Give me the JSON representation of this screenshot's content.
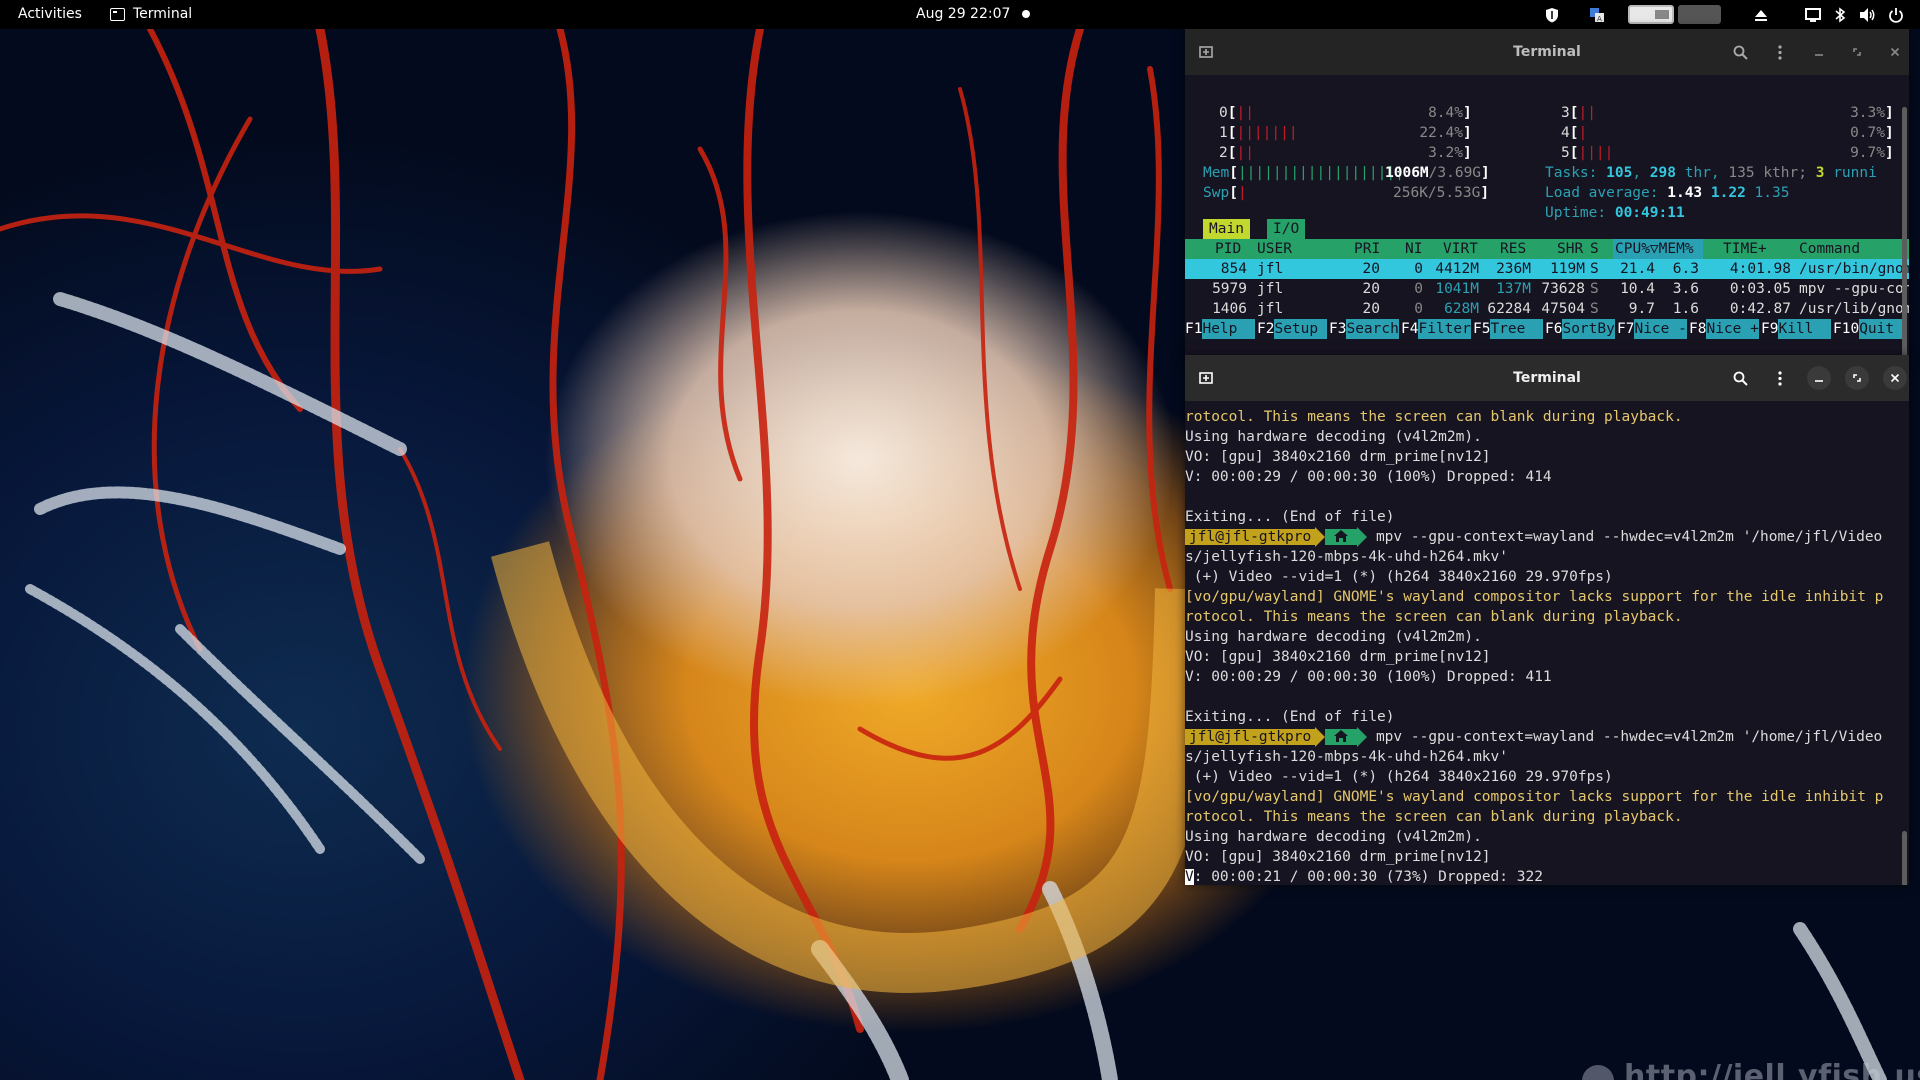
{
  "topbar": {
    "activities": "Activities",
    "app_name": "Terminal",
    "clock": "Aug 29  22:07",
    "icons": [
      "shield-icon",
      "translate-icon",
      "workspace-1",
      "workspace-2",
      "eject-icon",
      "display-icon",
      "bluetooth-icon",
      "volume-icon",
      "power-icon"
    ]
  },
  "wallpaper": {
    "watermark": "http://jell.yfish.us"
  },
  "term1": {
    "title": "Terminal",
    "htop": {
      "cpu": [
        {
          "id": "0",
          "bars": "||",
          "value": "8.4%"
        },
        {
          "id": "1",
          "bars": "|||||||",
          "value": "22.4%"
        },
        {
          "id": "2",
          "bars": "||",
          "value": "3.2%"
        },
        {
          "id": "3",
          "bars": "||",
          "value": "3.3%"
        },
        {
          "id": "4",
          "bars": "|",
          "value": "0.7%"
        },
        {
          "id": "5",
          "bars": "||||",
          "value": "9.7%"
        }
      ],
      "mem": {
        "label": "Mem",
        "bars": "|||||||||||||||||||",
        "used": "1006M",
        "total": "3.69G"
      },
      "swp": {
        "label": "Swp",
        "bars": "|",
        "used": "256K",
        "total": "5.53G"
      },
      "tasks": {
        "label": "Tasks:",
        "tasks": "105",
        "thr": "298",
        "thr_label": "thr,",
        "kthr": "135",
        "kthr_label": "kthr;",
        "running": "3",
        "running_label": "runni"
      },
      "load": {
        "label": "Load average:",
        "l1": "1.43",
        "l5": "1.22",
        "l15": "1.35"
      },
      "uptime": {
        "label": "Uptime:",
        "value": "00:49:11"
      },
      "tabs": {
        "main": "Main",
        "io": "I/O"
      },
      "header": {
        "pid": "PID",
        "user": "USER",
        "pri": "PRI",
        "ni": "NI",
        "virt": "VIRT",
        "res": "RES",
        "shr": "SHR",
        "s": "S",
        "cpu": "CPU%▽MEM%",
        "time": "TIME+",
        "command": "Command"
      },
      "processes": [
        {
          "pid": "854",
          "user": "jfl",
          "pri": "20",
          "ni": "0",
          "virt": "4412M",
          "res": "236M",
          "shr": "119M",
          "s": "S",
          "cpu": "21.4",
          "mem": "6.3",
          "time": "4:01.98",
          "command": "/usr/bin/gnom"
        },
        {
          "pid": "5979",
          "user": "jfl",
          "pri": "20",
          "ni": "0",
          "virt": "1041M",
          "res": "137M",
          "shr": "73628",
          "s": "S",
          "cpu": "10.4",
          "mem": "3.6",
          "time": "0:03.05",
          "command": "mpv --gpu-con"
        },
        {
          "pid": "1406",
          "user": "jfl",
          "pri": "20",
          "ni": "0",
          "virt": "628M",
          "res": "62284",
          "shr": "47504",
          "s": "S",
          "cpu": "9.7",
          "mem": "1.6",
          "time": "0:42.87",
          "command": "/usr/lib/gnom"
        }
      ],
      "fkeys": [
        {
          "key": "F1",
          "label": "Help  "
        },
        {
          "key": "F2",
          "label": "Setup "
        },
        {
          "key": "F3",
          "label": "Search"
        },
        {
          "key": "F4",
          "label": "Filter"
        },
        {
          "key": "F5",
          "label": "Tree  "
        },
        {
          "key": "F6",
          "label": "SortBy"
        },
        {
          "key": "F7",
          "label": "Nice -"
        },
        {
          "key": "F8",
          "label": "Nice +"
        },
        {
          "key": "F9",
          "label": "Kill  "
        },
        {
          "key": "F10",
          "label": "Quit "
        }
      ]
    }
  },
  "term2": {
    "title": "Terminal",
    "lines": [
      {
        "text": "rotocol. This means the screen can blank during playback.",
        "style": "yellow"
      },
      {
        "text": "Using hardware decoding (v4l2m2m).",
        "style": "plain"
      },
      {
        "text": "VO: [gpu] 3840x2160 drm_prime[nv12]",
        "style": "plain"
      },
      {
        "text": "V: 00:00:29 / 00:00:30 (100%) Dropped: 414",
        "style": "plain"
      },
      {
        "text": "",
        "style": "plain"
      },
      {
        "text": "Exiting... (End of file)",
        "style": "plain"
      },
      {
        "text": " mpv --gpu-context=wayland --hwdec=v4l2m2m '/home/jfl/Video",
        "style": "prompt",
        "user": "jfl@jfl-gtkpro"
      },
      {
        "text": "s/jellyfish-120-mbps-4k-uhd-h264.mkv'",
        "style": "plain"
      },
      {
        "text": " (+) Video --vid=1 (*) (h264 3840x2160 29.970fps)",
        "style": "plain"
      },
      {
        "text": "[vo/gpu/wayland] GNOME's wayland compositor lacks support for the idle inhibit p",
        "style": "yellow"
      },
      {
        "text": "rotocol. This means the screen can blank during playback.",
        "style": "yellow"
      },
      {
        "text": "Using hardware decoding (v4l2m2m).",
        "style": "plain"
      },
      {
        "text": "VO: [gpu] 3840x2160 drm_prime[nv12]",
        "style": "plain"
      },
      {
        "text": "V: 00:00:29 / 00:00:30 (100%) Dropped: 411",
        "style": "plain"
      },
      {
        "text": "",
        "style": "plain"
      },
      {
        "text": "Exiting... (End of file)",
        "style": "plain"
      },
      {
        "text": " mpv --gpu-context=wayland --hwdec=v4l2m2m '/home/jfl/Video",
        "style": "prompt",
        "user": "jfl@jfl-gtkpro"
      },
      {
        "text": "s/jellyfish-120-mbps-4k-uhd-h264.mkv'",
        "style": "plain"
      },
      {
        "text": " (+) Video --vid=1 (*) (h264 3840x2160 29.970fps)",
        "style": "plain"
      },
      {
        "text": "[vo/gpu/wayland] GNOME's wayland compositor lacks support for the idle inhibit p",
        "style": "yellow"
      },
      {
        "text": "rotocol. This means the screen can blank during playback.",
        "style": "yellow"
      },
      {
        "text": "Using hardware decoding (v4l2m2m).",
        "style": "plain"
      },
      {
        "text": "VO: [gpu] 3840x2160 drm_prime[nv12]",
        "style": "plain"
      },
      {
        "text": "V: 00:00:21 / 00:00:30 (73%) Dropped: 322",
        "style": "cursor"
      }
    ]
  },
  "colors": {
    "terminal_bg": "#171421",
    "htop_green": "#26a269",
    "htop_cyan": "#2aa1b3",
    "prompt_yellow": "#c2a11c",
    "warning_yellow": "#e5c76b"
  }
}
